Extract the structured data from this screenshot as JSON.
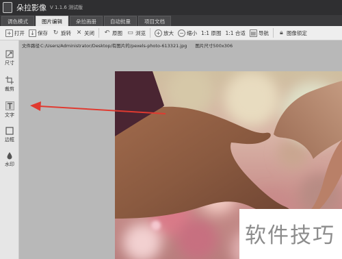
{
  "app": {
    "title": "朵拉影像",
    "version": "V 1.1.6 测试版"
  },
  "tabs": [
    {
      "label": "调色模式",
      "active": false
    },
    {
      "label": "图片编辑",
      "active": true
    },
    {
      "label": "朵拉画册",
      "active": false
    },
    {
      "label": "自动批量",
      "active": false
    },
    {
      "label": "项目文档",
      "active": false
    }
  ],
  "toolbar": {
    "open": "打开",
    "save": "保存",
    "rotate": "旋转",
    "close": "关闭",
    "original": "原图",
    "browse": "浏览",
    "zoom_in": "放大",
    "zoom_out": "缩小",
    "one_to_one": "1:1 原图",
    "fit": "1:1 合适",
    "navigate": "导航",
    "lock": "图像锁定"
  },
  "sidebar": {
    "items": [
      {
        "label": "尺寸",
        "icon": "resize-icon"
      },
      {
        "label": "裁剪",
        "icon": "crop-icon"
      },
      {
        "label": "文字",
        "icon": "text-icon",
        "active": true
      },
      {
        "label": "边框",
        "icon": "border-icon"
      },
      {
        "label": "水印",
        "icon": "watermark-icon"
      }
    ]
  },
  "file_info": {
    "path_label": "文件路径",
    "path": "C:/Users/Administrator/Desktop/有图片的/pexels-photo-613321.jpg",
    "size_label": "图片尺寸",
    "size": "500x306"
  },
  "watermark": {
    "text": "软件技巧"
  },
  "colors": {
    "titlebar": "#2f2f31",
    "workspace": "#b8b8b8",
    "arrow": "#e03a30"
  }
}
